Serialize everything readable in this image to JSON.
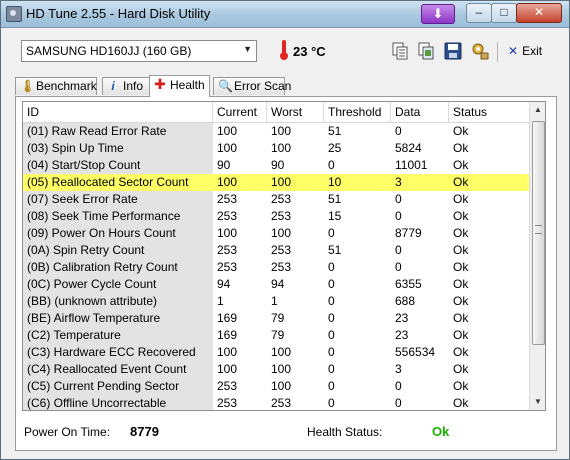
{
  "window": {
    "title": "HD Tune 2.55 - Hard Disk Utility"
  },
  "toolbar": {
    "drive": "SAMSUNG HD160JJ (160 GB)",
    "temperature": "23 °C",
    "exit_label": "Exit"
  },
  "tabs": [
    {
      "label": "Benchmark",
      "icon": "thermometer-icon",
      "active": false
    },
    {
      "label": "Info",
      "icon": "info-icon",
      "active": false
    },
    {
      "label": "Health",
      "icon": "health-cross-icon",
      "active": true
    },
    {
      "label": "Error Scan",
      "icon": "magnifier-icon",
      "active": false
    }
  ],
  "table": {
    "columns": [
      "ID",
      "Current",
      "Worst",
      "Threshold",
      "Data",
      "Status"
    ],
    "rows": [
      {
        "id": "(01) Raw Read Error Rate",
        "current": "100",
        "worst": "100",
        "threshold": "51",
        "data": "0",
        "status": "Ok"
      },
      {
        "id": "(03) Spin Up Time",
        "current": "100",
        "worst": "100",
        "threshold": "25",
        "data": "5824",
        "status": "Ok"
      },
      {
        "id": "(04) Start/Stop Count",
        "current": "90",
        "worst": "90",
        "threshold": "0",
        "data": "11001",
        "status": "Ok"
      },
      {
        "id": "(05) Reallocated Sector Count",
        "current": "100",
        "worst": "100",
        "threshold": "10",
        "data": "3",
        "status": "Ok",
        "highlighted": true
      },
      {
        "id": "(07) Seek Error Rate",
        "current": "253",
        "worst": "253",
        "threshold": "51",
        "data": "0",
        "status": "Ok"
      },
      {
        "id": "(08) Seek Time Performance",
        "current": "253",
        "worst": "253",
        "threshold": "15",
        "data": "0",
        "status": "Ok"
      },
      {
        "id": "(09) Power On Hours Count",
        "current": "100",
        "worst": "100",
        "threshold": "0",
        "data": "8779",
        "status": "Ok"
      },
      {
        "id": "(0A) Spin Retry Count",
        "current": "253",
        "worst": "253",
        "threshold": "51",
        "data": "0",
        "status": "Ok"
      },
      {
        "id": "(0B) Calibration Retry Count",
        "current": "253",
        "worst": "253",
        "threshold": "0",
        "data": "0",
        "status": "Ok"
      },
      {
        "id": "(0C) Power Cycle Count",
        "current": "94",
        "worst": "94",
        "threshold": "0",
        "data": "6355",
        "status": "Ok"
      },
      {
        "id": "(BB) (unknown attribute)",
        "current": "1",
        "worst": "1",
        "threshold": "0",
        "data": "688",
        "status": "Ok"
      },
      {
        "id": "(BE) Airflow Temperature",
        "current": "169",
        "worst": "79",
        "threshold": "0",
        "data": "23",
        "status": "Ok"
      },
      {
        "id": "(C2) Temperature",
        "current": "169",
        "worst": "79",
        "threshold": "0",
        "data": "23",
        "status": "Ok"
      },
      {
        "id": "(C3) Hardware ECC Recovered",
        "current": "100",
        "worst": "100",
        "threshold": "0",
        "data": "556534",
        "status": "Ok"
      },
      {
        "id": "(C4) Reallocated Event Count",
        "current": "100",
        "worst": "100",
        "threshold": "0",
        "data": "3",
        "status": "Ok"
      },
      {
        "id": "(C5) Current Pending Sector",
        "current": "253",
        "worst": "100",
        "threshold": "0",
        "data": "0",
        "status": "Ok"
      },
      {
        "id": "(C6) Offline Uncorrectable",
        "current": "253",
        "worst": "253",
        "threshold": "0",
        "data": "0",
        "status": "Ok"
      }
    ]
  },
  "footer": {
    "power_on_label": "Power On Time:",
    "power_on_value": "8779",
    "health_label": "Health Status:",
    "health_value": "Ok"
  },
  "colors": {
    "highlight_row": "#ffff66",
    "status_ok": "#19b400",
    "temperature_red": "#e12424"
  }
}
